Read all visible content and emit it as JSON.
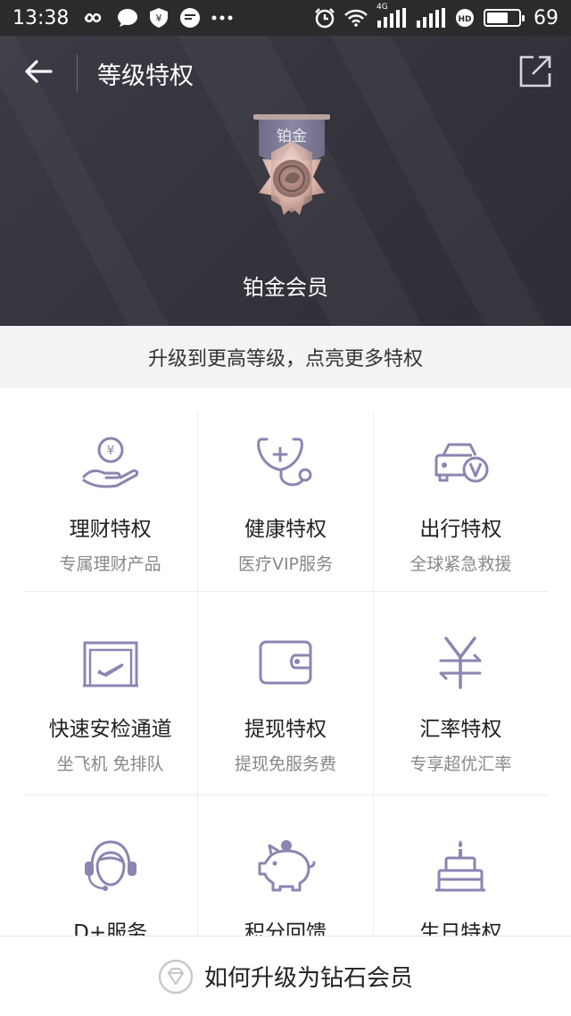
{
  "status_bar": {
    "time": "13:38",
    "signal_label": "4G",
    "battery_percent": "69",
    "battery_level": 0.69
  },
  "header": {
    "title": "等级特权",
    "back_icon": "back-arrow-icon",
    "share_icon": "share-external-icon"
  },
  "medal": {
    "ribbon_text": "铂金",
    "level_name": "铂金会员"
  },
  "upgrade_tip": "升级到更高等级，点亮更多特权",
  "privileges": [
    {
      "icon": "hand-coin-icon",
      "title": "理财特权",
      "subtitle": "专属理财产品"
    },
    {
      "icon": "stethoscope-icon",
      "title": "健康特权",
      "subtitle": "医疗VIP服务"
    },
    {
      "icon": "car-v-icon",
      "title": "出行特权",
      "subtitle": "全球紧急救援"
    },
    {
      "icon": "security-gate-icon",
      "title": "快速安检通道",
      "subtitle": "坐飞机 免排队"
    },
    {
      "icon": "wallet-icon",
      "title": "提现特权",
      "subtitle": "提现免服务费"
    },
    {
      "icon": "currency-exchange-icon",
      "title": "汇率特权",
      "subtitle": "专享超优汇率"
    },
    {
      "icon": "headset-agent-icon",
      "title": "D+服务",
      "subtitle": ""
    },
    {
      "icon": "piggy-bank-icon",
      "title": "积分回馈",
      "subtitle": ""
    },
    {
      "icon": "birthday-cake-icon",
      "title": "生日特权",
      "subtitle": ""
    }
  ],
  "bottom": {
    "label": "如何升级为钻石会员",
    "icon": "diamond-icon"
  },
  "colors": {
    "accent_icon": "#8a86b2",
    "header_bg": "#37353e",
    "medal": "#c9a79e"
  }
}
